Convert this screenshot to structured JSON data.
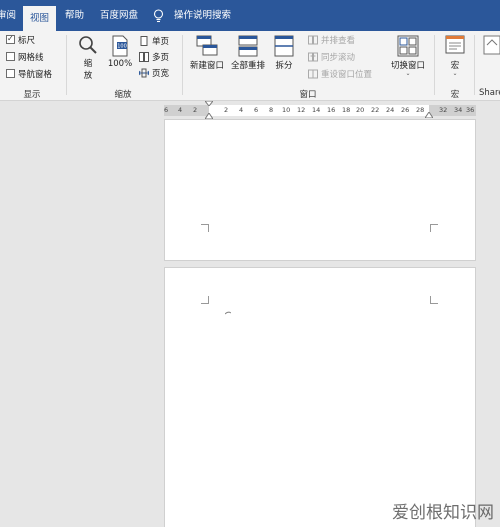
{
  "tabs": [
    {
      "id": "review",
      "label": "审阅"
    },
    {
      "id": "view",
      "label": "视图",
      "active": true
    },
    {
      "id": "help",
      "label": "帮助"
    },
    {
      "id": "baidu",
      "label": "百度网盘"
    },
    {
      "id": "tellme",
      "label": "操作说明搜索"
    }
  ],
  "show_group": {
    "label": "显示",
    "items": [
      {
        "label": "标尺",
        "checked": true
      },
      {
        "label": "网格线",
        "checked": false
      },
      {
        "label": "导航窗格",
        "checked": false
      }
    ]
  },
  "zoom_group": {
    "label": "缩放",
    "zoom_label_line1": "缩",
    "zoom_label_line2": "放",
    "percent_label": "100%",
    "one_page": "单页",
    "multi_page": "多页",
    "page_width": "页宽"
  },
  "window_group": {
    "label": "窗口",
    "new_window": "新建窗口",
    "arrange_all": "全部重排",
    "split": "拆分",
    "side_by_side": "并排查看",
    "sync_scroll": "同步滚动",
    "reset_position": "重设窗口位置",
    "switch_windows": "切换窗口"
  },
  "macro_group": {
    "label": "宏",
    "macro": "宏"
  },
  "share_partial": "Share",
  "ruler_numbers": [
    "6",
    "4",
    "2",
    "2",
    "4",
    "6",
    "8",
    "10",
    "12",
    "14",
    "16",
    "18",
    "20",
    "22",
    "24",
    "26",
    "28",
    "32",
    "34",
    "36"
  ],
  "watermark": "爱创根知识网",
  "colors": {
    "accent": "#2b579a"
  }
}
